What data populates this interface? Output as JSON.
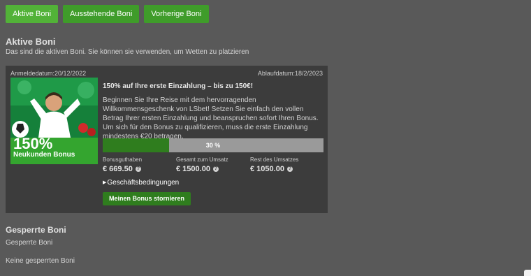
{
  "tabs": [
    {
      "label": "Aktive Boni"
    },
    {
      "label": "Ausstehende Boni"
    },
    {
      "label": "Vorherige Boni"
    }
  ],
  "active_section": {
    "title": "Aktive Boni",
    "description": "Das sind die aktiven Boni. Sie können sie verwenden, um Wetten zu platzieren"
  },
  "bonus_card": {
    "start_date": "Anmeldedatum:20/12/2022",
    "end_date": "Ablaufdatum:18/2/2023",
    "promo_percent": "150%",
    "promo_subtitle": "Neukunden Bonus",
    "title": "150% auf Ihre erste Einzahlung – bis zu 150€!",
    "description": "Beginnen Sie Ihre Reise mit dem hervorragenden Willkommensgeschenk von LSbet! Setzen Sie einfach den vollen Betrag Ihrer ersten Einzahlung und beanspruchen sofort Ihren Bonus. Um sich für den Bonus zu qualifizieren, muss die erste Einzahlung mindestens €20 betragen.",
    "progress_label": "30 %",
    "progress_fraction": 0.3,
    "stats": [
      {
        "label": "Bonusguthaben",
        "value": "€ 669.50"
      },
      {
        "label": "Gesamt zum Umsatz",
        "value": "€ 1500.00"
      },
      {
        "label": "Rest des Umsatzes",
        "value": "€ 1050.00"
      }
    ],
    "help_glyph": "?",
    "terms_label": "Geschäftsbedingungen",
    "terms_arrow": "▶",
    "cancel_label": "Meinen Bonus stornieren"
  },
  "blocked_section": {
    "title": "Gesperrte Boni",
    "subtitle": "Gesperrte Boni",
    "empty_text": "Keine gesperrten Boni"
  },
  "colors": {
    "background": "#595959",
    "tab_active": "#52b238",
    "tab": "#3f9c2a",
    "card": "#3c3c3c",
    "progress_fill": "#2f7d1e",
    "progress_track": "#9a9a9a"
  }
}
